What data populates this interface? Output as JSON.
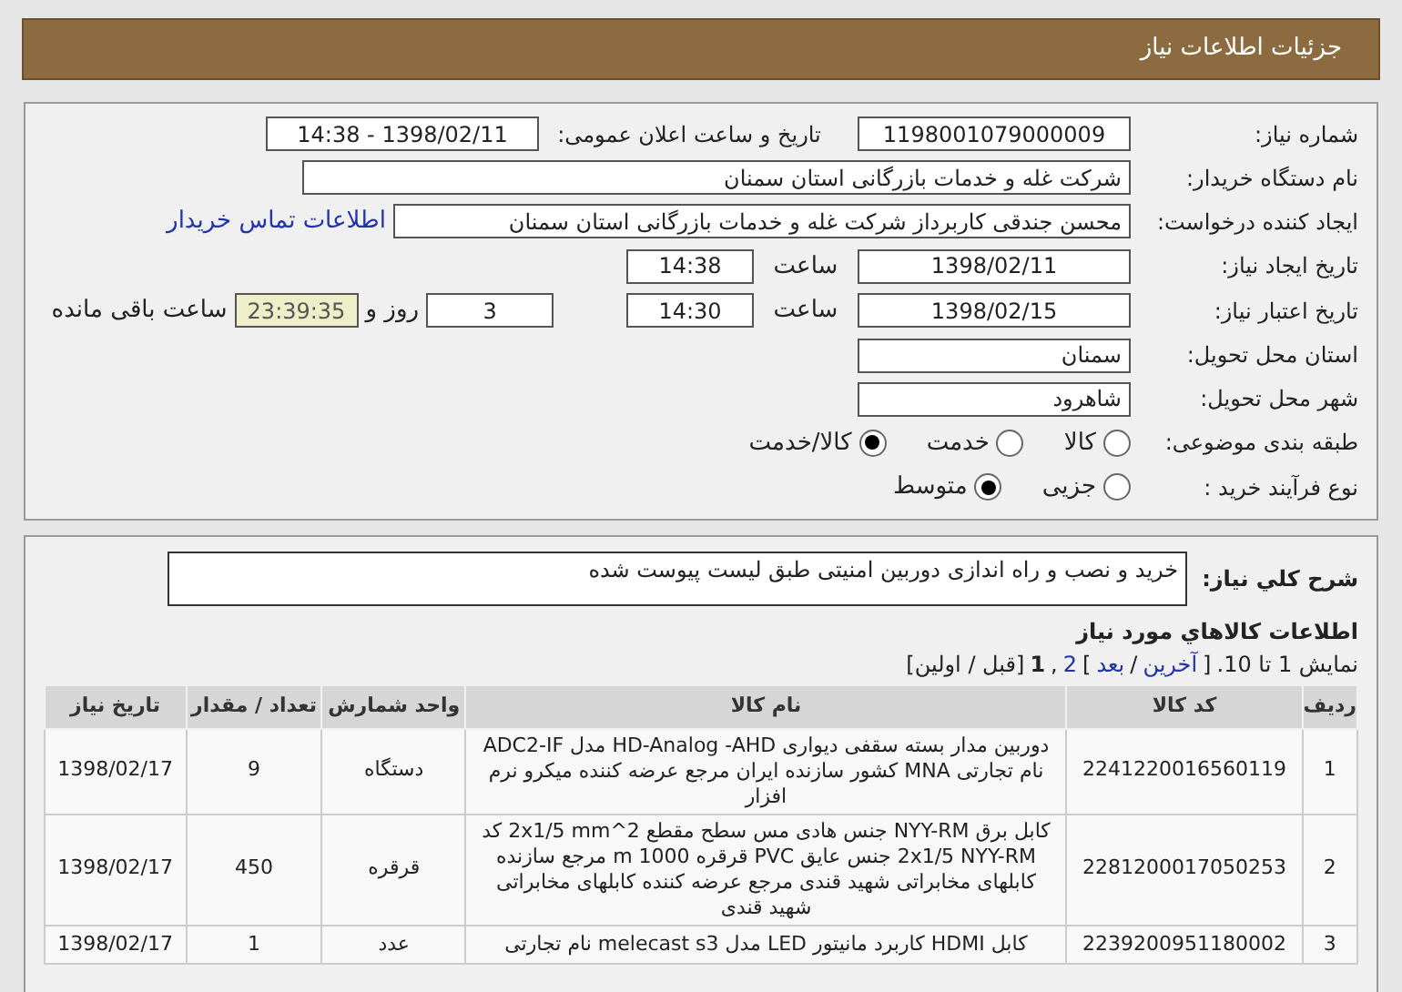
{
  "header": {
    "title": "جزئیات اطلاعات نیاز"
  },
  "details": {
    "need_number": {
      "label": "شماره نیاز:",
      "value": "1198001079000009"
    },
    "announce": {
      "label": "تاریخ و ساعت اعلان عمومی:",
      "value": "1398/02/11 - 14:38"
    },
    "buyer": {
      "label": "نام دستگاه خریدار:",
      "value": "شرکت غله و خدمات بازرگانی استان سمنان"
    },
    "requester": {
      "label": "ایجاد کننده درخواست:",
      "value": "محسن جندقی کاربرداز شرکت غله و خدمات بازرگانی استان سمنان",
      "link": "اطلاعات تماس خریدار"
    },
    "created": {
      "label": "تاریخ ایجاد نیاز:",
      "date": "1398/02/11",
      "time_label": "ساعت",
      "time": "14:38"
    },
    "valid": {
      "label": "تاریخ اعتبار نیاز:",
      "date": "1398/02/15",
      "time_label": "ساعت",
      "time": "14:30",
      "days": "3",
      "days_label": "روز و",
      "remaining": "23:39:35",
      "remaining_label": "ساعت باقی مانده"
    },
    "province": {
      "label": "استان محل تحویل:",
      "value": "سمنان"
    },
    "city": {
      "label": "شهر محل تحویل:",
      "value": "شاهرود"
    },
    "category": {
      "label": "طبقه بندی موضوعی:",
      "options": [
        {
          "label": "کالا",
          "selected": false
        },
        {
          "label": "خدمت",
          "selected": false
        },
        {
          "label": "کالا/خدمت",
          "selected": true
        }
      ]
    },
    "purchase_type": {
      "label": "نوع فرآیند خرید :",
      "options": [
        {
          "label": "جزیی",
          "selected": false
        },
        {
          "label": "متوسط",
          "selected": true
        }
      ]
    }
  },
  "summary": {
    "label": "شرح کلي نياز:",
    "value": "خرید و نصب و راه اندازی دوربین امنیتی طبق لیست پیوست شده"
  },
  "goods": {
    "title": "اطلاعات کالاهاي مورد نياز",
    "pagination": [
      {
        "kind": "text",
        "text": "نمایش 1 تا 10."
      },
      {
        "kind": "text",
        "text": "["
      },
      {
        "kind": "link",
        "text": "آخرین"
      },
      {
        "kind": "text",
        "text": "/"
      },
      {
        "kind": "link",
        "text": "بعد"
      },
      {
        "kind": "text",
        "text": "]"
      },
      {
        "kind": "link",
        "text": "2"
      },
      {
        "kind": "text",
        "text": ","
      },
      {
        "kind": "current",
        "text": "1"
      },
      {
        "kind": "text",
        "text": "[قبل / اولین]"
      }
    ],
    "columns": [
      "ردیف",
      "کد کالا",
      "نام کالا",
      "واحد شمارش",
      "تعداد / مقدار",
      "تاریخ نیاز"
    ],
    "rows": [
      [
        "1",
        "2241220016560119",
        "دوربین مدار بسته سقفی دیواری HD-Analog -AHD مدل ADC2-IF نام تجارتی MNA کشور سازنده ایران مرجع عرضه کننده میکرو نرم افزار",
        "دستگاه",
        "9",
        "1398/02/17"
      ],
      [
        "2",
        "2281200017050253",
        "کابل برق NYY-RM جنس هادی مس سطح مقطع 2x1/5 mm^2 کد 2x1/5 NYY-RM جنس عایق PVC قرقره 1000 m مرجع سازنده کابلهای مخابراتی شهید قندی مرجع عرضه کننده کابلهای مخابراتی شهید قندی",
        "قرقره",
        "450",
        "1398/02/17"
      ],
      [
        "3",
        "2239200951180002",
        "کابل HDMI کاربرد مانیتور LED مدل melecast s3 نام تجارتی",
        "عدد",
        "1",
        "1398/02/17"
      ]
    ]
  }
}
